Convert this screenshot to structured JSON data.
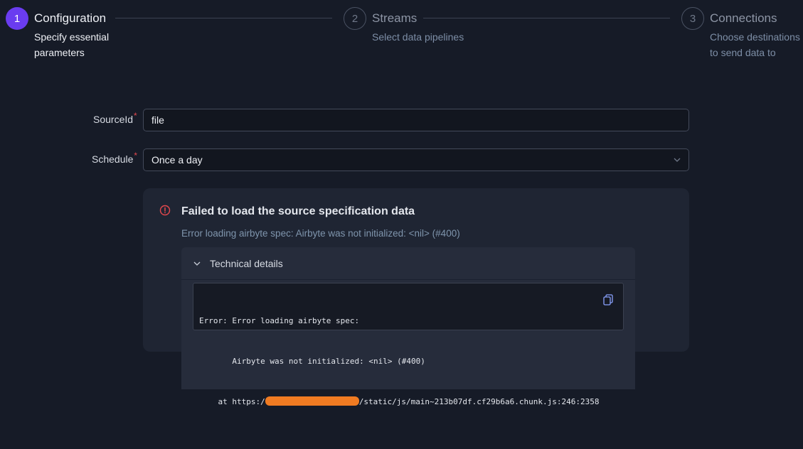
{
  "steps": [
    {
      "number": "1",
      "title": "Configuration",
      "desc_line1": "Specify essential",
      "desc_line2": "parameters"
    },
    {
      "number": "2",
      "title": "Streams",
      "desc_line1": "Select data pipelines",
      "desc_line2": ""
    },
    {
      "number": "3",
      "title": "Connections",
      "desc_line1": "Choose destinations",
      "desc_line2": "to send data to"
    }
  ],
  "form": {
    "source_id_label": "SourceId",
    "source_id_value": "file",
    "schedule_label": "Schedule",
    "schedule_value": "Once a day",
    "required_mark": "*"
  },
  "error": {
    "title": "Failed to load the source specification data",
    "message": "Error loading airbyte spec: Airbyte was not initialized: <nil> (#400)",
    "details_label": "Technical details",
    "code_line1": "Error: Error loading airbyte spec:",
    "code_line2": "       Airbyte was not initialized: <nil> (#400)",
    "code_line3_prefix": "    at https:/",
    "code_line3_suffix": "/static/js/main~213b07df.cf29b6a6.chunk.js:246:2358"
  },
  "colors": {
    "accent": "#6a3cf0",
    "error": "#e5484d",
    "redaction": "#f07b22"
  },
  "icons": {
    "error": "alert-circle-icon",
    "copy": "copy-icon",
    "chevron": "chevron-down-icon"
  }
}
